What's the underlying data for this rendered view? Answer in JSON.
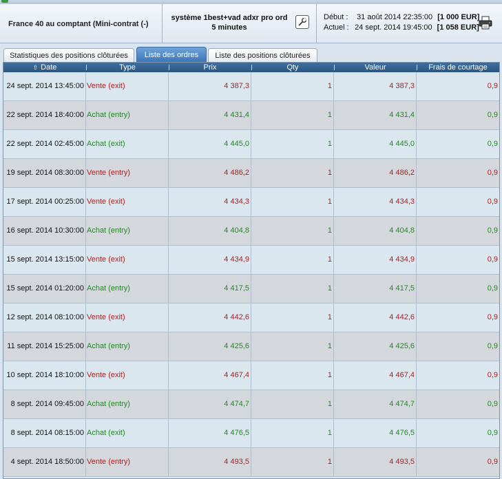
{
  "header": {
    "instrument": "France 40 au comptant (Mini-contrat  (-)",
    "system_name": "système 1best+vad adxr pro ord",
    "timeframe": "5 minutes",
    "start_label": "Début :",
    "start_date": "31 août 2014 22:35:00",
    "start_amount": "[1 000 EUR]",
    "current_label": "Actuel :",
    "current_date": "24 sept. 2014 19:45:00",
    "current_amount": "[1 058 EUR]"
  },
  "tabs": [
    {
      "label": "Statistiques des positions clôturées",
      "active": false
    },
    {
      "label": "Liste des ordres",
      "active": true
    },
    {
      "label": "Liste des positions clôturées",
      "active": false
    }
  ],
  "columns": [
    "Date",
    "Type",
    "Prix",
    "Qty",
    "Valeur",
    "Frais de courtage"
  ],
  "sort": {
    "column": "Date",
    "direction": "up"
  },
  "colors": {
    "sell": "#b01d1d",
    "buy": "#1f8a1f",
    "header": "#2d5680",
    "active_tab": "#3d77b8"
  },
  "orders": [
    {
      "date": "24 sept. 2014 13:45:00",
      "type": "Vente (exit)",
      "side": "sell",
      "prix": "4 387,3",
      "qty": "1",
      "valeur": "4 387,3",
      "frais": "0,9"
    },
    {
      "date": "22 sept. 2014 18:40:00",
      "type": "Achat (entry)",
      "side": "buy",
      "prix": "4 431,4",
      "qty": "1",
      "valeur": "4 431,4",
      "frais": "0,9"
    },
    {
      "date": "22 sept. 2014 02:45:00",
      "type": "Achat (exit)",
      "side": "buy",
      "prix": "4 445,0",
      "qty": "1",
      "valeur": "4 445,0",
      "frais": "0,9"
    },
    {
      "date": "19 sept. 2014 08:30:00",
      "type": "Vente (entry)",
      "side": "sell",
      "prix": "4 486,2",
      "qty": "1",
      "valeur": "4 486,2",
      "frais": "0,9"
    },
    {
      "date": "17 sept. 2014 00:25:00",
      "type": "Vente (exit)",
      "side": "sell",
      "prix": "4 434,3",
      "qty": "1",
      "valeur": "4 434,3",
      "frais": "0,9"
    },
    {
      "date": "16 sept. 2014 10:30:00",
      "type": "Achat (entry)",
      "side": "buy",
      "prix": "4 404,8",
      "qty": "1",
      "valeur": "4 404,8",
      "frais": "0,9"
    },
    {
      "date": "15 sept. 2014 13:15:00",
      "type": "Vente (exit)",
      "side": "sell",
      "prix": "4 434,9",
      "qty": "1",
      "valeur": "4 434,9",
      "frais": "0,9"
    },
    {
      "date": "15 sept. 2014 01:20:00",
      "type": "Achat (entry)",
      "side": "buy",
      "prix": "4 417,5",
      "qty": "1",
      "valeur": "4 417,5",
      "frais": "0,9"
    },
    {
      "date": "12 sept. 2014 08:10:00",
      "type": "Vente (exit)",
      "side": "sell",
      "prix": "4 442,6",
      "qty": "1",
      "valeur": "4 442,6",
      "frais": "0,9"
    },
    {
      "date": "11 sept. 2014 15:25:00",
      "type": "Achat (entry)",
      "side": "buy",
      "prix": "4 425,6",
      "qty": "1",
      "valeur": "4 425,6",
      "frais": "0,9"
    },
    {
      "date": "10 sept. 2014 18:10:00",
      "type": "Vente (exit)",
      "side": "sell",
      "prix": "4 467,4",
      "qty": "1",
      "valeur": "4 467,4",
      "frais": "0,9"
    },
    {
      "date": "8 sept. 2014 09:45:00",
      "type": "Achat (entry)",
      "side": "buy",
      "prix": "4 474,7",
      "qty": "1",
      "valeur": "4 474,7",
      "frais": "0,9"
    },
    {
      "date": "8 sept. 2014 08:15:00",
      "type": "Achat (exit)",
      "side": "buy",
      "prix": "4 476,5",
      "qty": "1",
      "valeur": "4 476,5",
      "frais": "0,9"
    },
    {
      "date": "4 sept. 2014 18:50:00",
      "type": "Vente (entry)",
      "side": "sell",
      "prix": "4 493,5",
      "qty": "1",
      "valeur": "4 493,5",
      "frais": "0,9"
    }
  ]
}
